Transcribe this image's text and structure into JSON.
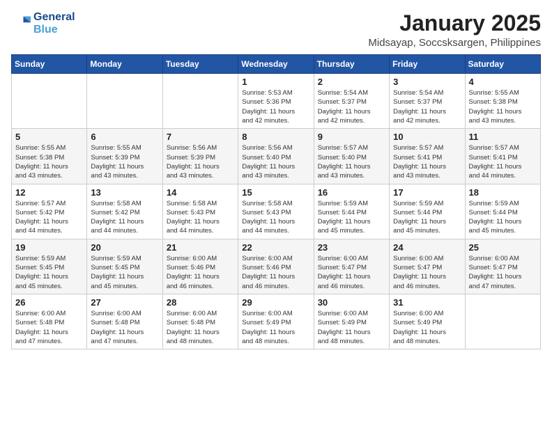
{
  "logo": {
    "line1": "General",
    "line2": "Blue"
  },
  "title": "January 2025",
  "subtitle": "Midsayap, Soccsksargen, Philippines",
  "days_of_week": [
    "Sunday",
    "Monday",
    "Tuesday",
    "Wednesday",
    "Thursday",
    "Friday",
    "Saturday"
  ],
  "weeks": [
    [
      {
        "day": "",
        "info": ""
      },
      {
        "day": "",
        "info": ""
      },
      {
        "day": "",
        "info": ""
      },
      {
        "day": "1",
        "info": "Sunrise: 5:53 AM\nSunset: 5:36 PM\nDaylight: 11 hours\nand 42 minutes."
      },
      {
        "day": "2",
        "info": "Sunrise: 5:54 AM\nSunset: 5:37 PM\nDaylight: 11 hours\nand 42 minutes."
      },
      {
        "day": "3",
        "info": "Sunrise: 5:54 AM\nSunset: 5:37 PM\nDaylight: 11 hours\nand 42 minutes."
      },
      {
        "day": "4",
        "info": "Sunrise: 5:55 AM\nSunset: 5:38 PM\nDaylight: 11 hours\nand 43 minutes."
      }
    ],
    [
      {
        "day": "5",
        "info": "Sunrise: 5:55 AM\nSunset: 5:38 PM\nDaylight: 11 hours\nand 43 minutes."
      },
      {
        "day": "6",
        "info": "Sunrise: 5:55 AM\nSunset: 5:39 PM\nDaylight: 11 hours\nand 43 minutes."
      },
      {
        "day": "7",
        "info": "Sunrise: 5:56 AM\nSunset: 5:39 PM\nDaylight: 11 hours\nand 43 minutes."
      },
      {
        "day": "8",
        "info": "Sunrise: 5:56 AM\nSunset: 5:40 PM\nDaylight: 11 hours\nand 43 minutes."
      },
      {
        "day": "9",
        "info": "Sunrise: 5:57 AM\nSunset: 5:40 PM\nDaylight: 11 hours\nand 43 minutes."
      },
      {
        "day": "10",
        "info": "Sunrise: 5:57 AM\nSunset: 5:41 PM\nDaylight: 11 hours\nand 43 minutes."
      },
      {
        "day": "11",
        "info": "Sunrise: 5:57 AM\nSunset: 5:41 PM\nDaylight: 11 hours\nand 44 minutes."
      }
    ],
    [
      {
        "day": "12",
        "info": "Sunrise: 5:57 AM\nSunset: 5:42 PM\nDaylight: 11 hours\nand 44 minutes."
      },
      {
        "day": "13",
        "info": "Sunrise: 5:58 AM\nSunset: 5:42 PM\nDaylight: 11 hours\nand 44 minutes."
      },
      {
        "day": "14",
        "info": "Sunrise: 5:58 AM\nSunset: 5:43 PM\nDaylight: 11 hours\nand 44 minutes."
      },
      {
        "day": "15",
        "info": "Sunrise: 5:58 AM\nSunset: 5:43 PM\nDaylight: 11 hours\nand 44 minutes."
      },
      {
        "day": "16",
        "info": "Sunrise: 5:59 AM\nSunset: 5:44 PM\nDaylight: 11 hours\nand 45 minutes."
      },
      {
        "day": "17",
        "info": "Sunrise: 5:59 AM\nSunset: 5:44 PM\nDaylight: 11 hours\nand 45 minutes."
      },
      {
        "day": "18",
        "info": "Sunrise: 5:59 AM\nSunset: 5:44 PM\nDaylight: 11 hours\nand 45 minutes."
      }
    ],
    [
      {
        "day": "19",
        "info": "Sunrise: 5:59 AM\nSunset: 5:45 PM\nDaylight: 11 hours\nand 45 minutes."
      },
      {
        "day": "20",
        "info": "Sunrise: 5:59 AM\nSunset: 5:45 PM\nDaylight: 11 hours\nand 45 minutes."
      },
      {
        "day": "21",
        "info": "Sunrise: 6:00 AM\nSunset: 5:46 PM\nDaylight: 11 hours\nand 46 minutes."
      },
      {
        "day": "22",
        "info": "Sunrise: 6:00 AM\nSunset: 5:46 PM\nDaylight: 11 hours\nand 46 minutes."
      },
      {
        "day": "23",
        "info": "Sunrise: 6:00 AM\nSunset: 5:47 PM\nDaylight: 11 hours\nand 46 minutes."
      },
      {
        "day": "24",
        "info": "Sunrise: 6:00 AM\nSunset: 5:47 PM\nDaylight: 11 hours\nand 46 minutes."
      },
      {
        "day": "25",
        "info": "Sunrise: 6:00 AM\nSunset: 5:47 PM\nDaylight: 11 hours\nand 47 minutes."
      }
    ],
    [
      {
        "day": "26",
        "info": "Sunrise: 6:00 AM\nSunset: 5:48 PM\nDaylight: 11 hours\nand 47 minutes."
      },
      {
        "day": "27",
        "info": "Sunrise: 6:00 AM\nSunset: 5:48 PM\nDaylight: 11 hours\nand 47 minutes."
      },
      {
        "day": "28",
        "info": "Sunrise: 6:00 AM\nSunset: 5:48 PM\nDaylight: 11 hours\nand 48 minutes."
      },
      {
        "day": "29",
        "info": "Sunrise: 6:00 AM\nSunset: 5:49 PM\nDaylight: 11 hours\nand 48 minutes."
      },
      {
        "day": "30",
        "info": "Sunrise: 6:00 AM\nSunset: 5:49 PM\nDaylight: 11 hours\nand 48 minutes."
      },
      {
        "day": "31",
        "info": "Sunrise: 6:00 AM\nSunset: 5:49 PM\nDaylight: 11 hours\nand 48 minutes."
      },
      {
        "day": "",
        "info": ""
      }
    ]
  ]
}
